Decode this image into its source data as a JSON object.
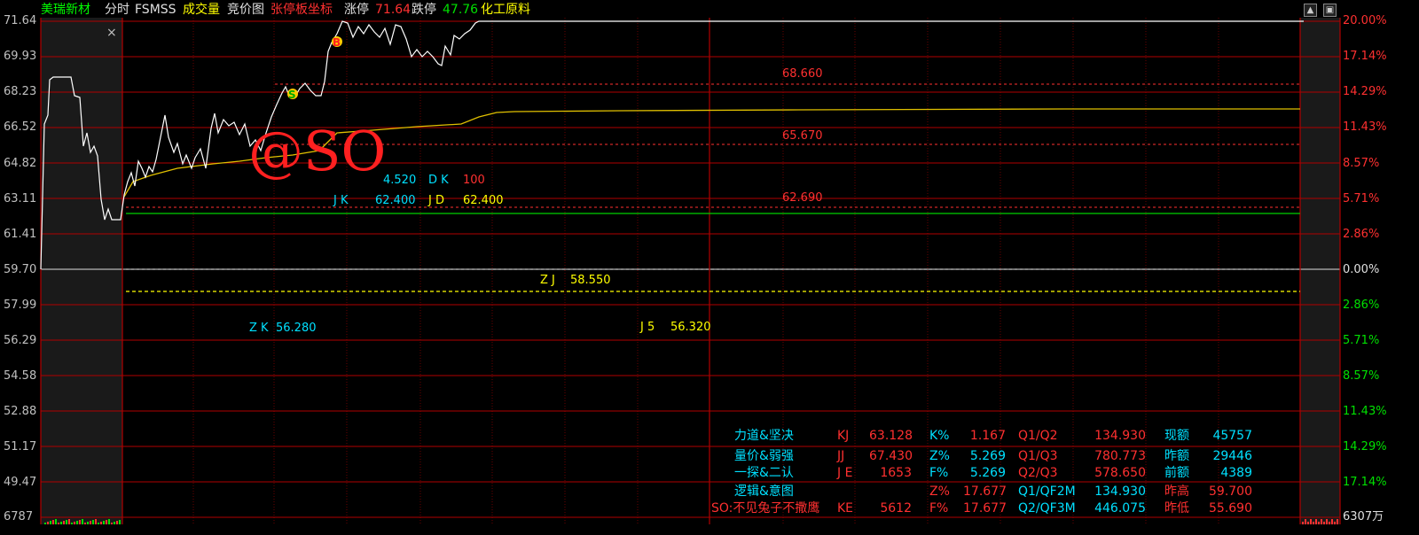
{
  "header": {
    "stock_name": "美瑞新材",
    "mode": "分时",
    "indicator": "FSMSS",
    "volume_tab": "成交量",
    "auction_tab": "竞价图",
    "limit_coord": "张停板坐标",
    "limit_up_label": "涨停",
    "limit_up_value": "71.64",
    "limit_down_label": "跌停",
    "limit_down_value": "47.76",
    "sector": "化工原料"
  },
  "colors": {
    "name": "#00ff00",
    "up": "#ff3030",
    "down": "#00e000",
    "yellow": "#ffff00",
    "cyan": "#00e0ff",
    "grid": "#c00000"
  },
  "axis_left": [
    "71.64",
    "69.93",
    "68.23",
    "66.52",
    "64.82",
    "63.11",
    "61.41",
    "59.70",
    "57.99",
    "56.29",
    "54.58",
    "52.88",
    "51.17",
    "49.47"
  ],
  "axis_right": [
    "20.00%",
    "17.14%",
    "14.29%",
    "11.43%",
    "8.57%",
    "5.71%",
    "2.86%",
    "0.00%",
    "2.86%",
    "5.71%",
    "8.57%",
    "11.43%",
    "14.29%",
    "17.14%"
  ],
  "volume_left": "6787",
  "volume_right": "6307万",
  "levels": {
    "l1": "68.660",
    "l2": "65.670",
    "l3": "62.690"
  },
  "annotations": {
    "dk_prefix": "4.520",
    "dk_label": "D K",
    "dk_value": "100",
    "jk_label": "J K",
    "jk_value": "62.400",
    "jd_label": "J D",
    "jd_value": "62.400",
    "zj_label": "Z J",
    "zj_value": "58.550",
    "zk_label": "Z K",
    "zk_value": "56.280",
    "j5_label": "J 5",
    "j5_value": "56.320"
  },
  "markers": {
    "buy": "S",
    "sell": "B"
  },
  "close_icon": "×",
  "watermark": "@SO",
  "stats": {
    "r1": {
      "title": "力道&坚决",
      "k": "KJ",
      "v": "63.128",
      "k2": "K%",
      "v2": "1.167",
      "k3": "Q1/Q2",
      "v3": "134.930",
      "k4": "现额",
      "v4": "45757"
    },
    "r2": {
      "title": "量价&弱强",
      "k": "JJ",
      "v": "67.430",
      "k2": "Z%",
      "v2": "5.269",
      "k3": "Q1/Q3",
      "v3": "780.773",
      "k4": "昨额",
      "v4": "29446"
    },
    "r3": {
      "title": "一探&二认",
      "k": "J E",
      "v": "1653",
      "k2": "F%",
      "v2": "5.269",
      "k3": "Q2/Q3",
      "v3": "578.650",
      "k4": "前额",
      "v4": "4389"
    },
    "r4": {
      "title": "逻辑&意图",
      "k2": "Z%",
      "v2": "17.677",
      "k3": "Q1/QF2M",
      "v3": "134.930",
      "k4": "昨高",
      "v4": "59.700"
    },
    "r5": {
      "title": "SO:不见兔子不撒鹰",
      "k": "KE",
      "v": "5612",
      "k2": "F%",
      "v2": "17.677",
      "k3": "Q2/QF3M",
      "v3": "446.075",
      "k4": "昨低",
      "v4": "55.690"
    }
  }
}
